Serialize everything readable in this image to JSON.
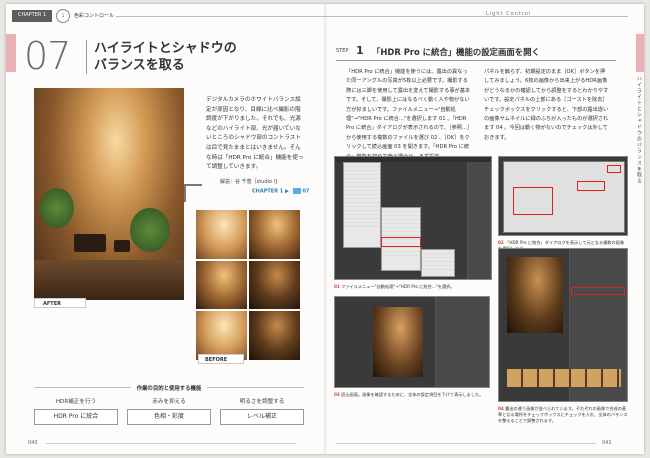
{
  "header": {
    "chapter_tab": "CHAPTER 1",
    "chapter_icon": "1",
    "chapter_title": "色彩コントロール",
    "right_title": "Light Control"
  },
  "section": {
    "number": "07",
    "title_line1": "ハイライトとシャドウの",
    "title_line2": "バランスを取る"
  },
  "intro": {
    "text": "デジタルカメラのホワイトバランス設定が原因となり、目線に比べ撮影の階調度が下がりました。それでも、光源などのハイライト部、光が届いていないところのシャドウ部のコントラストは目で見たままとはいきません。そんな時は「HDR Pro に統合」機能を使って調整していきます。",
    "author": "解説：谷 千恵［studio Ⅰ]",
    "chapter_ref": "CHAPTER 1 ▶",
    "chapter_ref_num": "07"
  },
  "labels": {
    "after": "AFTER",
    "before": "BEFORE"
  },
  "features": {
    "heading": "作業の目的と使用する機能",
    "items": [
      {
        "label": "HDR補正を行う",
        "tool": "HDR Pro に統合"
      },
      {
        "label": "赤みを抑える",
        "tool": "色相・彩度"
      },
      {
        "label": "明るさを調整する",
        "tool": "レベル補正"
      }
    ]
  },
  "step": {
    "badge": "STEP",
    "number": "1",
    "title": "「HDR Pro に統合」機能の設定画面を開く"
  },
  "body": {
    "col1": "「HDR Pro に統合」機能を使うには、露出の異なった同一アングルの写真が5枚以上必要です。撮影する際には三脚を使用して露出を変えて撮影する事が基本です。そして、撮影上にはなるべく動く人や物がない方が好ましいです。ファイルメニュー→\"自動処理\"→\"HDR Pro に統合...\"を選択します 01 。「HDR Pro に統合」ダイアログが表示されるので、［参照...］から使用する複数のファイルを選び 02 、［OK］をクリックして読込画面 03 を開きます。「HDR Pro に統合」機能を初めて使う場合は、まず設定",
    "col2": "パネルを触らず、初期設定のまま［OK］ボタンを押してみましょう。6枚の画像から出来上がるHDR画像がどうなるかの確認してから調整をするとわかりやすいです。設定パネルの上部にある［ゴーストを除去］チェックボックスをクリックすると、下部の露出違いの画像サムネイルに緑のふちが入ったものが選択されます 04 。今回は動く物がないのでチェックは外しておきます。"
  },
  "captions": {
    "c01_num": "01",
    "c01": "ファイルメニュー\"自動処理\"→\"HDR Pro に統合...\"を選択。",
    "c02_num": "02",
    "c02": "「HDR Pro に統合」ダイアログを表示して元となる複数の画像を選択します。",
    "c03_num": "03",
    "c03": "読込画面。画像を確認するために、全体の設定項目を下げて表示しました。",
    "c04_num": "04",
    "c04": "露出の違う画像が並べられています。それぞれの画像で合成の基準となる場所をチェックボックスにチェックを入れ、全体のバランスを整えることで調整されます。"
  },
  "side_title": "ハイライトとシャドウのバランスを取る",
  "pages": {
    "left": "040",
    "right": "041"
  }
}
